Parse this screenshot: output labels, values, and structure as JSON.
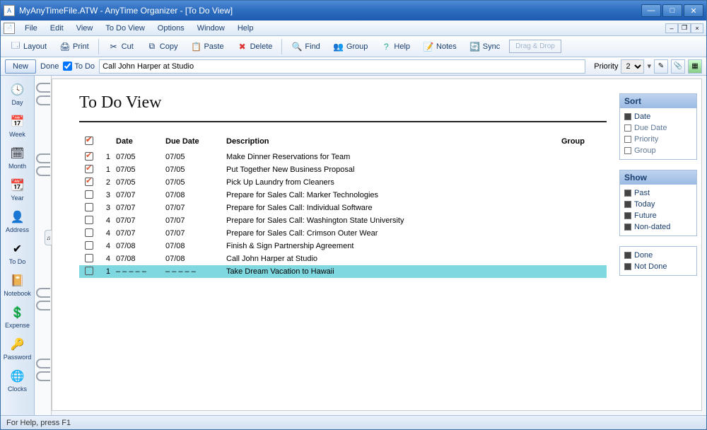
{
  "window": {
    "title": "MyAnyTimeFile.ATW - AnyTime Organizer - [To Do View]"
  },
  "menu": {
    "file": "File",
    "edit": "Edit",
    "view": "View",
    "todoview": "To Do View",
    "options": "Options",
    "window": "Window",
    "help": "Help"
  },
  "toolbar": {
    "layout": "Layout",
    "print": "Print",
    "cut": "Cut",
    "copy": "Copy",
    "paste": "Paste",
    "del": "Delete",
    "find": "Find",
    "group": "Group",
    "help": "Help",
    "notes": "Notes",
    "sync": "Sync",
    "dragdrop": "Drag & Drop"
  },
  "subbar": {
    "new_btn": "New",
    "done": "Done",
    "todo": "To Do",
    "input_value": "Call John Harper at Studio",
    "priority_label": "Priority",
    "priority_value": "2"
  },
  "nav": {
    "day": "Day",
    "week": "Week",
    "month": "Month",
    "year": "Year",
    "address": "Address",
    "todo": "To Do",
    "notebook": "Notebook",
    "expense": "Expense",
    "password": "Password",
    "clocks": "Clocks"
  },
  "page": {
    "title": "To Do View",
    "headers": {
      "check": "",
      "pri": "",
      "date": "Date",
      "due": "Due Date",
      "desc": "Description",
      "group": "Group"
    },
    "rows": [
      {
        "done": true,
        "pri": "1",
        "date": "07/05",
        "due": "07/05",
        "desc": "Make Dinner Reservations for Team",
        "sel": false,
        "note": false
      },
      {
        "done": true,
        "pri": "1",
        "date": "07/05",
        "due": "07/05",
        "desc": "Put Together New Business Proposal",
        "sel": false,
        "note": false
      },
      {
        "done": true,
        "pri": "2",
        "date": "07/05",
        "due": "07/05",
        "desc": "Pick Up Laundry from Cleaners",
        "sel": false,
        "note": false
      },
      {
        "done": false,
        "pri": "3",
        "date": "07/07",
        "due": "07/08",
        "desc": "Prepare for Sales Call: Marker Technologies",
        "sel": false,
        "note": false
      },
      {
        "done": false,
        "pri": "3",
        "date": "07/07",
        "due": "07/07",
        "desc": "Prepare for Sales Call: Individual Software",
        "sel": false,
        "note": false
      },
      {
        "done": false,
        "pri": "4",
        "date": "07/07",
        "due": "07/07",
        "desc": "Prepare for Sales Call: Washington State University",
        "sel": false,
        "note": false
      },
      {
        "done": false,
        "pri": "4",
        "date": "07/07",
        "due": "07/07",
        "desc": "Prepare for Sales Call: Crimson Outer Wear",
        "sel": false,
        "note": false
      },
      {
        "done": false,
        "pri": "4",
        "date": "07/08",
        "due": "07/08",
        "desc": "Finish & Sign Partnership Agreement",
        "sel": false,
        "note": true
      },
      {
        "done": false,
        "pri": "4",
        "date": "07/08",
        "due": "07/08",
        "desc": "Call John Harper at Studio",
        "sel": false,
        "note": false
      },
      {
        "done": false,
        "pri": "1",
        "date": "– – – – –",
        "due": "– – – – –",
        "desc": "Take Dream Vacation to Hawaii",
        "sel": true,
        "note": false
      }
    ]
  },
  "panels": {
    "sort": {
      "title": "Sort",
      "options": [
        {
          "label": "Date",
          "on": true
        },
        {
          "label": "Due Date",
          "on": false
        },
        {
          "label": "Priority",
          "on": false
        },
        {
          "label": "Group",
          "on": false
        }
      ]
    },
    "show": {
      "title": "Show",
      "options": [
        {
          "label": "Past",
          "on": true
        },
        {
          "label": "Today",
          "on": true
        },
        {
          "label": "Future",
          "on": true
        },
        {
          "label": "Non-dated",
          "on": true
        }
      ]
    },
    "status": {
      "title": "",
      "options": [
        {
          "label": "Done",
          "on": true
        },
        {
          "label": "Not Done",
          "on": true
        }
      ]
    }
  },
  "statusbar": {
    "text": "For Help, press F1"
  },
  "colors": {
    "accent": "#2f6fc0",
    "selected_row": "#7fd8e0"
  }
}
